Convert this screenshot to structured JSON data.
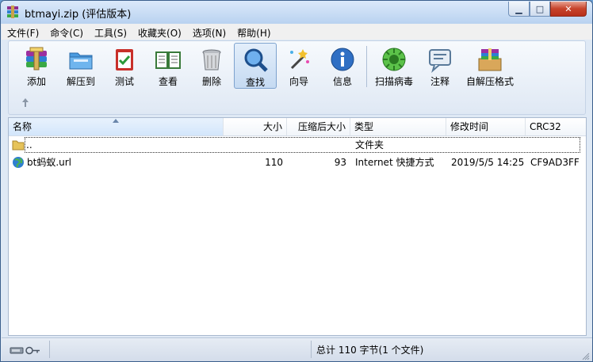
{
  "window": {
    "title": "btmayi.zip (评估版本)"
  },
  "menu": [
    "文件(F)",
    "命令(C)",
    "工具(S)",
    "收藏夹(O)",
    "选项(N)",
    "帮助(H)"
  ],
  "toolbar": {
    "add": "添加",
    "extract": "解压到",
    "test": "测试",
    "view": "查看",
    "delete": "删除",
    "find": "查找",
    "wizard": "向导",
    "info": "信息",
    "scan": "扫描病毒",
    "comment": "注释",
    "sfx": "自解压格式"
  },
  "columns": {
    "name": "名称",
    "size": "大小",
    "packed": "压缩后大小",
    "type": "类型",
    "modified": "修改时间",
    "crc": "CRC32"
  },
  "rows": [
    {
      "name": "..",
      "size": "",
      "packed": "",
      "type": "文件夹",
      "modified": "",
      "crc": ""
    },
    {
      "name": "bt蚂蚁.url",
      "size": "110",
      "packed": "93",
      "type": "Internet 快捷方式",
      "modified": "2019/5/5 14:25",
      "crc": "CF9AD3FF"
    }
  ],
  "status": {
    "summary": "总计 110 字节(1 个文件)"
  },
  "colors": {
    "title_bg": "#b9d2f0",
    "close_btn": "#c7432b",
    "sorted_header": "#d3e6fb"
  }
}
